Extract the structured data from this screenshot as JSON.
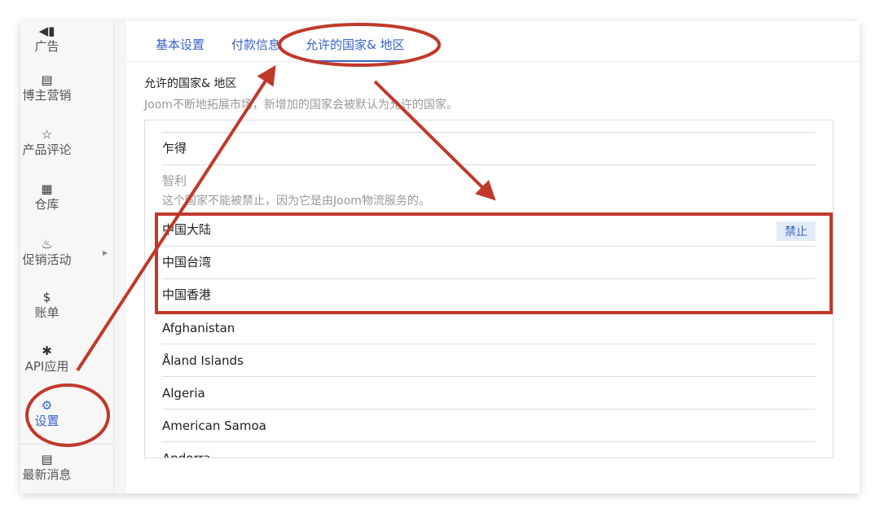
{
  "sidebar": {
    "items": [
      {
        "label": "广告",
        "icon": "megaphone-icon",
        "glyph": "📢"
      },
      {
        "label": "博主营销",
        "icon": "blogger-icon",
        "glyph": "▤"
      },
      {
        "label": "产品评论",
        "icon": "star-icon",
        "glyph": "☆"
      },
      {
        "label": "仓库",
        "icon": "warehouse-icon",
        "glyph": "▦"
      },
      {
        "label": "促销活动",
        "icon": "fire-icon",
        "glyph": "♨"
      },
      {
        "label": "账单",
        "icon": "dollar-icon",
        "glyph": "$"
      },
      {
        "label": "API应用",
        "icon": "puzzle-icon",
        "glyph": "✱"
      },
      {
        "label": "设置",
        "icon": "gear-icon",
        "glyph": "⚙"
      },
      {
        "label": "最新消息",
        "icon": "news-icon",
        "glyph": "▤"
      }
    ]
  },
  "tabs": [
    "基本设置",
    "付款信息",
    "允许的国家& 地区"
  ],
  "section": {
    "title": "允许的国家& 地区",
    "subtitle": "Joom不断地拓展市场，新增加的国家会被默认为允许的国家。"
  },
  "countries": [
    {
      "name": "乍得"
    },
    {
      "name": "智利",
      "note": "这个国家不能被禁止，因为它是由Joom物流服务的。"
    },
    {
      "name": "中国大陆",
      "action": "禁止"
    },
    {
      "name": "中国台湾"
    },
    {
      "name": "中国香港"
    },
    {
      "name": "Afghanistan"
    },
    {
      "name": "Åland Islands"
    },
    {
      "name": "Algeria"
    },
    {
      "name": "American Samoa"
    },
    {
      "name": "Andorra"
    }
  ],
  "annotation_color": "#c0392b"
}
